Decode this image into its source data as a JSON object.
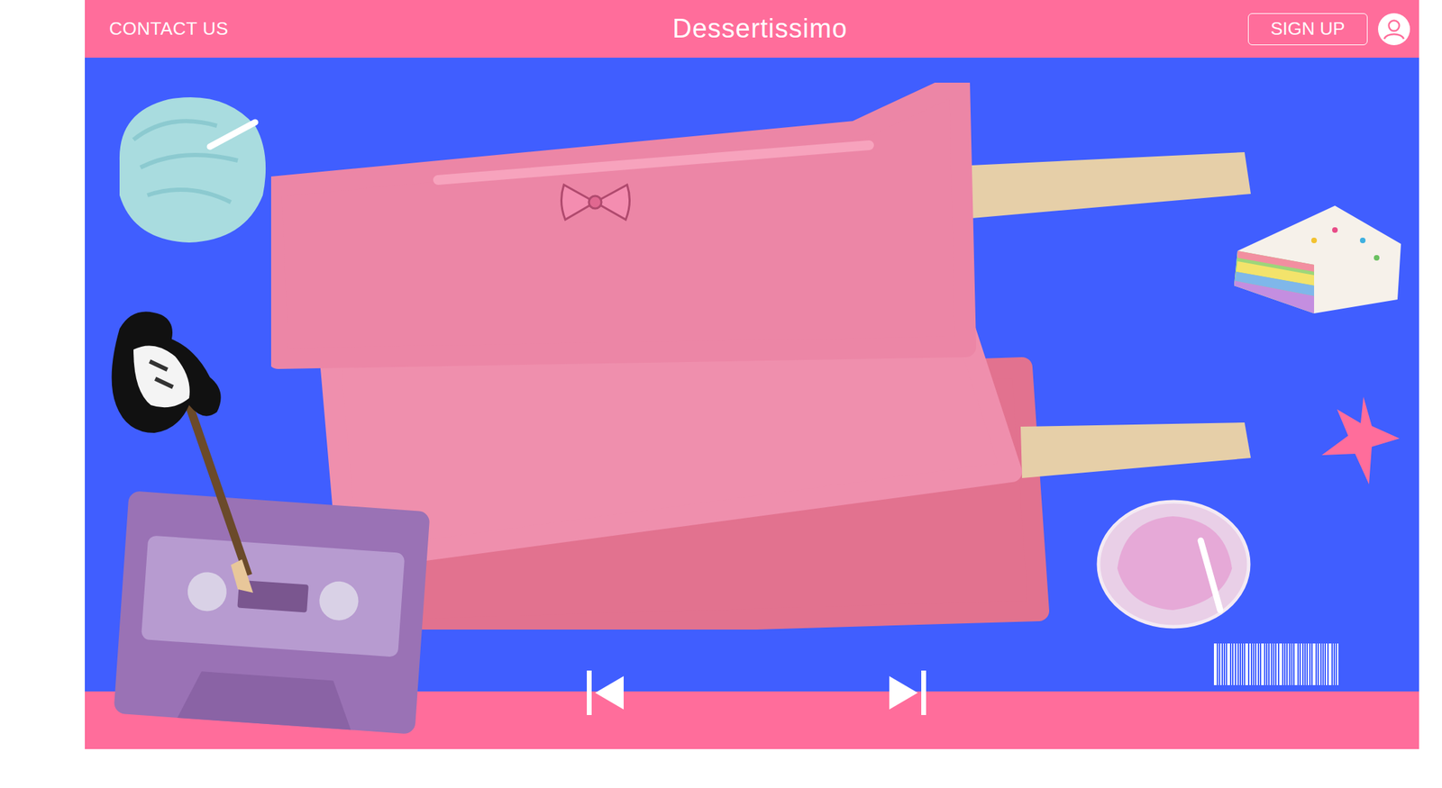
{
  "header": {
    "contact": "CONTACT US",
    "title": "Dessertissimo",
    "signup": "SIGN UP"
  }
}
